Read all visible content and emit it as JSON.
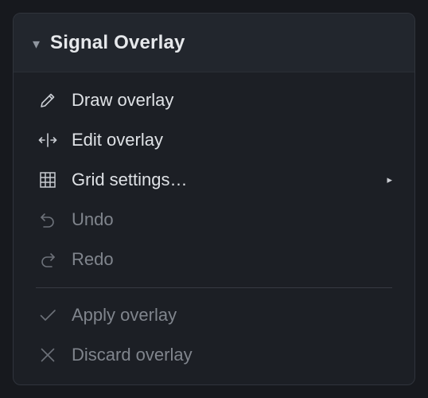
{
  "panel": {
    "title": "Signal Overlay",
    "caret": "▾",
    "collapse_icon": "caret-down-icon"
  },
  "menu": {
    "items": [
      {
        "label": "Draw overlay",
        "icon": "pencil-icon",
        "enabled": true
      },
      {
        "label": "Edit overlay",
        "icon": "resize-horizontal-icon",
        "enabled": true
      },
      {
        "label": "Grid settings…",
        "icon": "grid-icon",
        "enabled": true,
        "submenu_arrow": "▸"
      },
      {
        "label": "Undo",
        "icon": "undo-icon",
        "enabled": false
      },
      {
        "label": "Redo",
        "icon": "redo-icon",
        "enabled": false
      }
    ],
    "footer_items": [
      {
        "label": "Apply overlay",
        "icon": "check-icon",
        "enabled": false
      },
      {
        "label": "Discard overlay",
        "icon": "close-icon",
        "enabled": false
      }
    ]
  },
  "colors": {
    "background": "#17191e",
    "panel": "#1c1f25",
    "header": "#22262d",
    "text_enabled": "#dfe2e6",
    "text_disabled": "#80858d"
  }
}
